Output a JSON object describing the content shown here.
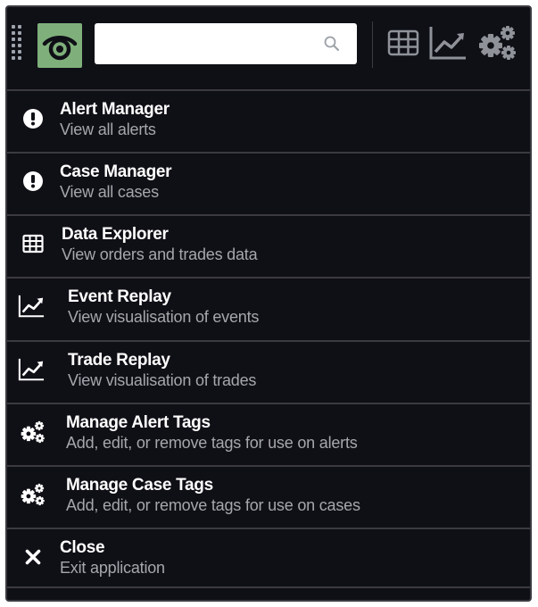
{
  "toolbar": {
    "search": {
      "value": "",
      "placeholder": ""
    },
    "buttons": [
      {
        "icon": "table-icon"
      },
      {
        "icon": "line-chart-icon"
      },
      {
        "icon": "gears-icon"
      }
    ]
  },
  "menu": {
    "items": [
      {
        "title": "Alert Manager",
        "subtitle": "View all alerts",
        "icon": "alert-icon"
      },
      {
        "title": "Case Manager",
        "subtitle": "View all cases",
        "icon": "alert-icon"
      },
      {
        "title": "Data Explorer",
        "subtitle": "View orders and trades data",
        "icon": "table-icon"
      },
      {
        "title": "Event Replay",
        "subtitle": "View visualisation of events",
        "icon": "line-chart-icon"
      },
      {
        "title": "Trade Replay",
        "subtitle": "View visualisation of trades",
        "icon": "line-chart-icon"
      },
      {
        "title": "Manage Alert Tags",
        "subtitle": "Add, edit, or remove tags for use on alerts",
        "icon": "gears-icon"
      },
      {
        "title": "Manage Case Tags",
        "subtitle": "Add, edit, or remove tags for use on cases",
        "icon": "gears-icon"
      },
      {
        "title": "Close",
        "subtitle": "Exit application",
        "icon": "close-icon"
      }
    ]
  },
  "colors": {
    "background": "#0f0f16",
    "divider": "#3a3a40",
    "logo": "#7fb07b",
    "title": "#ffffff",
    "subtitle": "#a6a7ad"
  }
}
